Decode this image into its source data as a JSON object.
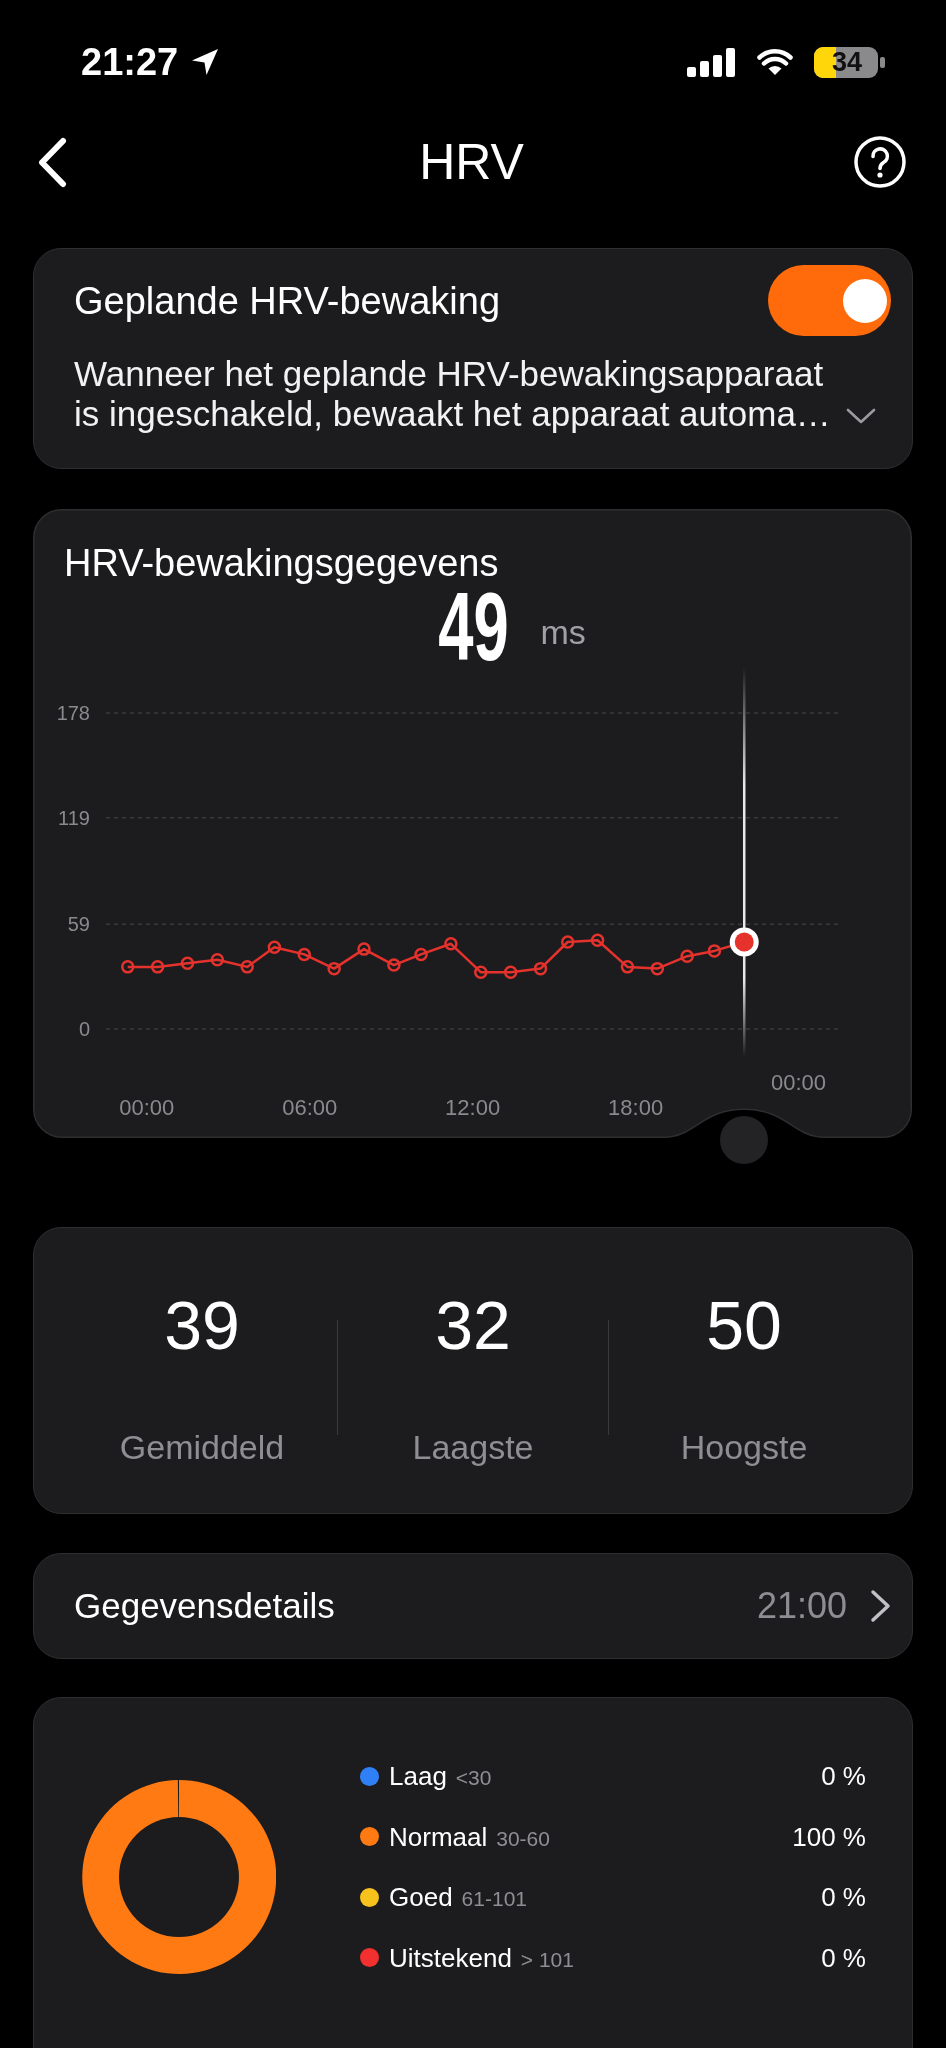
{
  "status_bar": {
    "time": "21:27",
    "battery": "34"
  },
  "header": {
    "title": "HRV"
  },
  "schedule": {
    "title": "Geplande HRV-bewaking",
    "on": true,
    "description": "Wanneer het geplande HRV-bewakingsapparaat is ingeschakeld, bewaakt het apparaat automa…",
    "expanded": false
  },
  "monitoring": {
    "title": "HRV-bewakingsgegevens",
    "reading": "49",
    "unit": "ms",
    "axis_end_label": "00:00",
    "chart_data": {
      "type": "line",
      "x": [
        -0.7,
        0.4,
        1.5,
        2.6,
        3.7,
        4.7,
        5.8,
        6.9,
        8.0,
        9.1,
        10.1,
        11.2,
        12.3,
        13.4,
        14.5,
        15.5,
        16.6,
        17.7,
        18.8,
        19.9,
        20.9,
        22.0
      ],
      "series": [
        {
          "color": "#e5322d",
          "marker": "o",
          "values": [
            35,
            35,
            37,
            39,
            35,
            46,
            42,
            34,
            45,
            36,
            42,
            48,
            32,
            32,
            34,
            49,
            50,
            35,
            34,
            41,
            44,
            49
          ]
        }
      ],
      "xlim": [
        -1.5,
        25.6
      ],
      "ylim": [
        0,
        178
      ],
      "xticks": [
        {
          "value": 0,
          "label": "00:00"
        },
        {
          "value": 6,
          "label": "06:00"
        },
        {
          "value": 12,
          "label": "12:00"
        },
        {
          "value": 18,
          "label": "18:00"
        }
      ],
      "yticks": [
        0,
        59,
        119,
        178
      ],
      "ref_lines": [
        {
          "axis": "x",
          "value": 22.0
        }
      ]
    }
  },
  "stats": [
    {
      "value": "39",
      "label": "Gemiddeld"
    },
    {
      "value": "32",
      "label": "Laagste"
    },
    {
      "value": "50",
      "label": "Hoogste"
    }
  ],
  "details": {
    "label": "Gegevensdetails",
    "time": "21:00"
  },
  "distribution": {
    "chart_data": {
      "type": "donut",
      "values": [
        0,
        100,
        0,
        0
      ]
    },
    "legend": [
      {
        "label": "Laag",
        "range": "<30",
        "percent": "0 %",
        "color": "#2f80f6"
      },
      {
        "label": "Normaal",
        "range": "30-60",
        "percent": "100 %",
        "color": "#ff7a12"
      },
      {
        "label": "Goed",
        "range": "61-101",
        "percent": "0 %",
        "color": "#f8c21c"
      },
      {
        "label": "Uitstekend",
        "range": "> 101",
        "percent": "0 %",
        "color": "#f2302f"
      }
    ]
  }
}
